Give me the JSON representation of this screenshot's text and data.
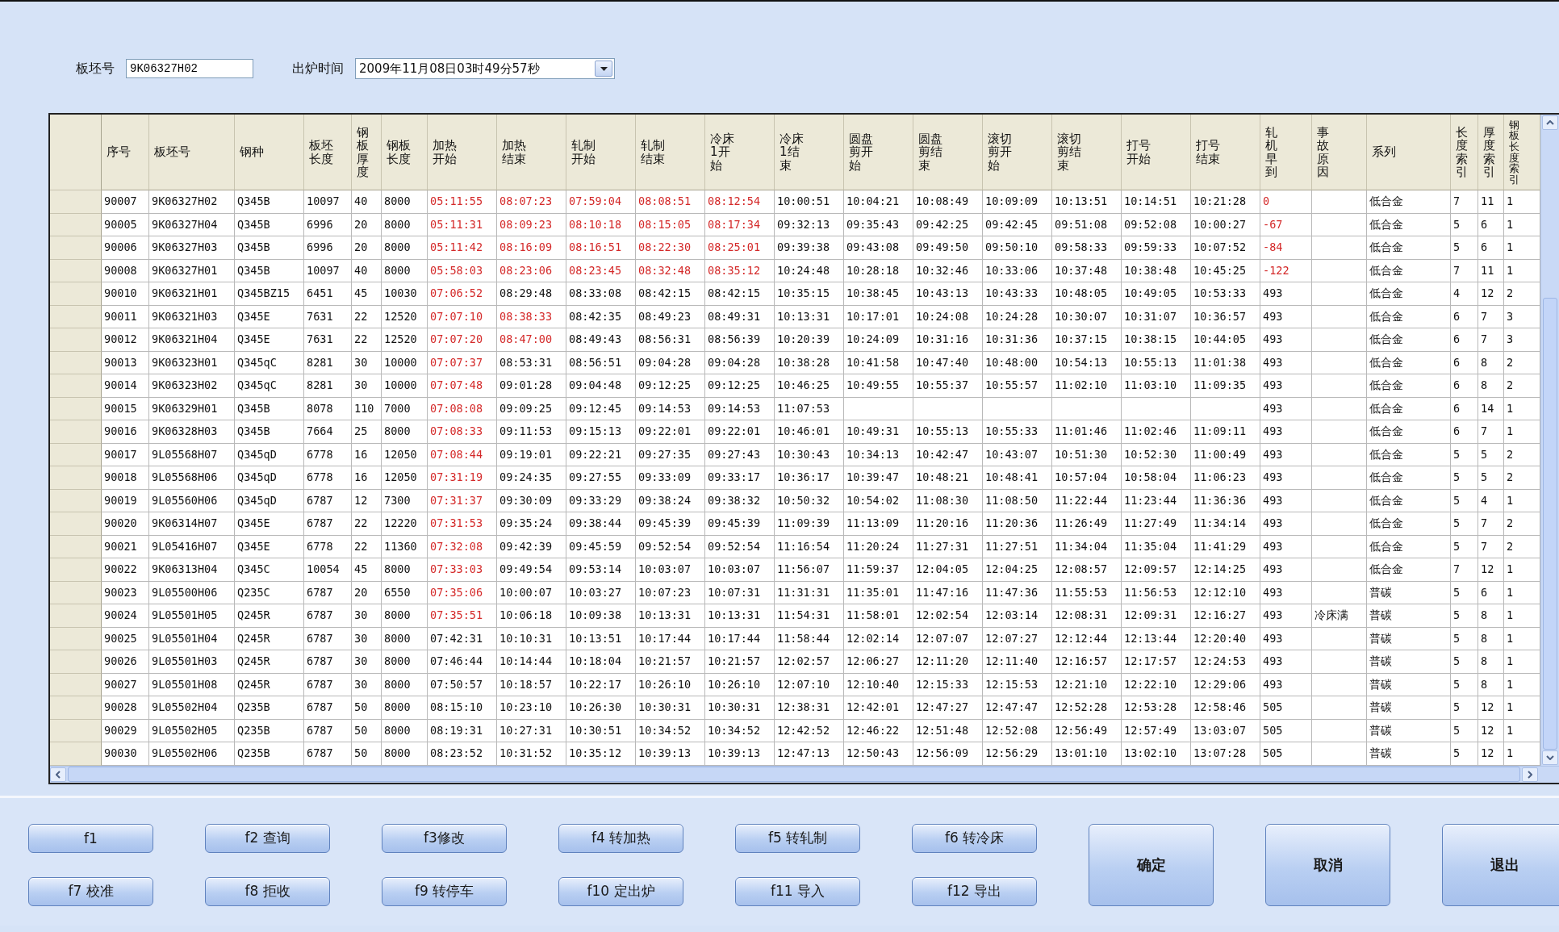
{
  "filter": {
    "slab_label": "板坯号",
    "slab_value": "9K06327H02",
    "time_label": "出炉时间",
    "time_value": "2009年11月08日03时49分57秒"
  },
  "table": {
    "columns": [
      "序号",
      "板坯号",
      "钢种",
      "板坯长度",
      "钢板厚度",
      "钢板长度",
      "加热开始",
      "加热结束",
      "轧制开始",
      "轧制结束",
      "冷床1开始",
      "冷床1结束",
      "圆盘剪开始",
      "圆盘剪结束",
      "滚切剪开始",
      "滚切剪结束",
      "打号开始",
      "打号结束",
      "轧机早到",
      "事故原因",
      "系列",
      "长度索引",
      "厚度索引",
      "钢板长度索引"
    ],
    "rows": [
      {
        "cells": [
          "90007",
          "9K06327H02",
          "Q345B",
          "10097",
          "40",
          "8000",
          "05:11:55",
          "08:07:23",
          "07:59:04",
          "08:08:51",
          "08:12:54",
          "10:00:51",
          "10:04:21",
          "10:08:49",
          "10:09:09",
          "10:13:51",
          "10:14:51",
          "10:21:28",
          "0",
          null,
          "低合金",
          "7",
          "11",
          "1"
        ],
        "alert": [
          true,
          true,
          true,
          true,
          true,
          true
        ]
      },
      {
        "cells": [
          "90005",
          "9K06327H04",
          "Q345B",
          "6996",
          "20",
          "8000",
          "05:11:31",
          "08:09:23",
          "08:10:18",
          "08:15:05",
          "08:17:34",
          "09:32:13",
          "09:35:43",
          "09:42:25",
          "09:42:45",
          "09:51:08",
          "09:52:08",
          "10:00:27",
          "-67",
          null,
          "低合金",
          "5",
          "6",
          "1"
        ],
        "alert": [
          true,
          true,
          true,
          true,
          true,
          true
        ]
      },
      {
        "cells": [
          "90006",
          "9K06327H03",
          "Q345B",
          "6996",
          "20",
          "8000",
          "05:11:42",
          "08:16:09",
          "08:16:51",
          "08:22:30",
          "08:25:01",
          "09:39:38",
          "09:43:08",
          "09:49:50",
          "09:50:10",
          "09:58:33",
          "09:59:33",
          "10:07:52",
          "-84",
          null,
          "低合金",
          "5",
          "6",
          "1"
        ],
        "alert": [
          true,
          true,
          true,
          true,
          true,
          true
        ]
      },
      {
        "cells": [
          "90008",
          "9K06327H01",
          "Q345B",
          "10097",
          "40",
          "8000",
          "05:58:03",
          "08:23:06",
          "08:23:45",
          "08:32:48",
          "08:35:12",
          "10:24:48",
          "10:28:18",
          "10:32:46",
          "10:33:06",
          "10:37:48",
          "10:38:48",
          "10:45:25",
          "-122",
          null,
          "低合金",
          "7",
          "11",
          "1"
        ],
        "alert": [
          true,
          true,
          true,
          true,
          true,
          true
        ]
      },
      {
        "cells": [
          "90010",
          "9K06321H01",
          "Q345BZ15",
          "6451",
          "45",
          "10030",
          "07:06:52",
          "08:29:48",
          "08:33:08",
          "08:42:15",
          "08:42:15",
          "10:35:15",
          "10:38:45",
          "10:43:13",
          "10:43:33",
          "10:48:05",
          "10:49:05",
          "10:53:33",
          "493",
          null,
          "低合金",
          "4",
          "12",
          "2"
        ],
        "alert": [
          true,
          false,
          false,
          false,
          false,
          false
        ]
      },
      {
        "cells": [
          "90011",
          "9K06321H03",
          "Q345E",
          "7631",
          "22",
          "12520",
          "07:07:10",
          "08:38:33",
          "08:42:35",
          "08:49:23",
          "08:49:31",
          "10:13:31",
          "10:17:01",
          "10:24:08",
          "10:24:28",
          "10:30:07",
          "10:31:07",
          "10:36:57",
          "493",
          null,
          "低合金",
          "6",
          "7",
          "3"
        ],
        "alert": [
          true,
          true,
          false,
          false,
          false,
          false
        ]
      },
      {
        "cells": [
          "90012",
          "9K06321H04",
          "Q345E",
          "7631",
          "22",
          "12520",
          "07:07:20",
          "08:47:00",
          "08:49:43",
          "08:56:31",
          "08:56:39",
          "10:20:39",
          "10:24:09",
          "10:31:16",
          "10:31:36",
          "10:37:15",
          "10:38:15",
          "10:44:05",
          "493",
          null,
          "低合金",
          "6",
          "7",
          "3"
        ],
        "alert": [
          true,
          true,
          false,
          false,
          false,
          false
        ]
      },
      {
        "cells": [
          "90013",
          "9K06323H01",
          "Q345qC",
          "8281",
          "30",
          "10000",
          "07:07:37",
          "08:53:31",
          "08:56:51",
          "09:04:28",
          "09:04:28",
          "10:38:28",
          "10:41:58",
          "10:47:40",
          "10:48:00",
          "10:54:13",
          "10:55:13",
          "11:01:38",
          "493",
          null,
          "低合金",
          "6",
          "8",
          "2"
        ],
        "alert": [
          true,
          false,
          false,
          false,
          false,
          false
        ]
      },
      {
        "cells": [
          "90014",
          "9K06323H02",
          "Q345qC",
          "8281",
          "30",
          "10000",
          "07:07:48",
          "09:01:28",
          "09:04:48",
          "09:12:25",
          "09:12:25",
          "10:46:25",
          "10:49:55",
          "10:55:37",
          "10:55:57",
          "11:02:10",
          "11:03:10",
          "11:09:35",
          "493",
          null,
          "低合金",
          "6",
          "8",
          "2"
        ],
        "alert": [
          true,
          false,
          false,
          false,
          false,
          false
        ]
      },
      {
        "cells": [
          "90015",
          "9K06329H01",
          "Q345B",
          "8078",
          "110",
          "7000",
          "07:08:08",
          "09:09:25",
          "09:12:45",
          "09:14:53",
          "09:14:53",
          "11:07:53",
          null,
          null,
          null,
          null,
          null,
          null,
          "493",
          null,
          "低合金",
          "6",
          "14",
          "1"
        ],
        "alert": [
          true,
          false,
          false,
          false,
          false,
          false
        ]
      },
      {
        "cells": [
          "90016",
          "9K06328H03",
          "Q345B",
          "7664",
          "25",
          "8000",
          "07:08:33",
          "09:11:53",
          "09:15:13",
          "09:22:01",
          "09:22:01",
          "10:46:01",
          "10:49:31",
          "10:55:13",
          "10:55:33",
          "11:01:46",
          "11:02:46",
          "11:09:11",
          "493",
          null,
          "低合金",
          "6",
          "7",
          "1"
        ],
        "alert": [
          true,
          false,
          false,
          false,
          false,
          false
        ]
      },
      {
        "cells": [
          "90017",
          "9L05568H07",
          "Q345qD",
          "6778",
          "16",
          "12050",
          "07:08:44",
          "09:19:01",
          "09:22:21",
          "09:27:35",
          "09:27:43",
          "10:30:43",
          "10:34:13",
          "10:42:47",
          "10:43:07",
          "10:51:30",
          "10:52:30",
          "11:00:49",
          "493",
          null,
          "低合金",
          "5",
          "5",
          "2"
        ],
        "alert": [
          true,
          false,
          false,
          false,
          false,
          false
        ]
      },
      {
        "cells": [
          "90018",
          "9L05568H06",
          "Q345qD",
          "6778",
          "16",
          "12050",
          "07:31:19",
          "09:24:35",
          "09:27:55",
          "09:33:09",
          "09:33:17",
          "10:36:17",
          "10:39:47",
          "10:48:21",
          "10:48:41",
          "10:57:04",
          "10:58:04",
          "11:06:23",
          "493",
          null,
          "低合金",
          "5",
          "5",
          "2"
        ],
        "alert": [
          true,
          false,
          false,
          false,
          false,
          false
        ]
      },
      {
        "cells": [
          "90019",
          "9L05560H06",
          "Q345qD",
          "6787",
          "12",
          "7300",
          "07:31:37",
          "09:30:09",
          "09:33:29",
          "09:38:24",
          "09:38:32",
          "10:50:32",
          "10:54:02",
          "11:08:30",
          "11:08:50",
          "11:22:44",
          "11:23:44",
          "11:36:36",
          "493",
          null,
          "低合金",
          "5",
          "4",
          "1"
        ],
        "alert": [
          true,
          false,
          false,
          false,
          false,
          false
        ]
      },
      {
        "cells": [
          "90020",
          "9K06314H07",
          "Q345E",
          "6787",
          "22",
          "12220",
          "07:31:53",
          "09:35:24",
          "09:38:44",
          "09:45:39",
          "09:45:39",
          "11:09:39",
          "11:13:09",
          "11:20:16",
          "11:20:36",
          "11:26:49",
          "11:27:49",
          "11:34:14",
          "493",
          null,
          "低合金",
          "5",
          "7",
          "2"
        ],
        "alert": [
          true,
          false,
          false,
          false,
          false,
          false
        ]
      },
      {
        "cells": [
          "90021",
          "9L05416H07",
          "Q345E",
          "6778",
          "22",
          "11360",
          "07:32:08",
          "09:42:39",
          "09:45:59",
          "09:52:54",
          "09:52:54",
          "11:16:54",
          "11:20:24",
          "11:27:31",
          "11:27:51",
          "11:34:04",
          "11:35:04",
          "11:41:29",
          "493",
          null,
          "低合金",
          "5",
          "7",
          "2"
        ],
        "alert": [
          true,
          false,
          false,
          false,
          false,
          false
        ]
      },
      {
        "cells": [
          "90022",
          "9K06313H04",
          "Q345C",
          "10054",
          "45",
          "8000",
          "07:33:03",
          "09:49:54",
          "09:53:14",
          "10:03:07",
          "10:03:07",
          "11:56:07",
          "11:59:37",
          "12:04:05",
          "12:04:25",
          "12:08:57",
          "12:09:57",
          "12:14:25",
          "493",
          null,
          "低合金",
          "7",
          "12",
          "1"
        ],
        "alert": [
          true,
          false,
          false,
          false,
          false,
          false
        ]
      },
      {
        "cells": [
          "90023",
          "9L05500H06",
          "Q235C",
          "6787",
          "20",
          "6550",
          "07:35:06",
          "10:00:07",
          "10:03:27",
          "10:07:23",
          "10:07:31",
          "11:31:31",
          "11:35:01",
          "11:47:16",
          "11:47:36",
          "11:55:53",
          "11:56:53",
          "12:12:10",
          "493",
          null,
          "普碳",
          "5",
          "6",
          "1"
        ],
        "alert": [
          true,
          false,
          false,
          false,
          false,
          false
        ]
      },
      {
        "cells": [
          "90024",
          "9L05501H05",
          "Q245R",
          "6787",
          "30",
          "8000",
          "07:35:51",
          "10:06:18",
          "10:09:38",
          "10:13:31",
          "10:13:31",
          "11:54:31",
          "11:58:01",
          "12:02:54",
          "12:03:14",
          "12:08:31",
          "12:09:31",
          "12:16:27",
          "493",
          "冷床满",
          "普碳",
          "5",
          "8",
          "1"
        ],
        "alert": [
          true,
          false,
          false,
          false,
          false,
          false
        ]
      },
      {
        "cells": [
          "90025",
          "9L05501H04",
          "Q245R",
          "6787",
          "30",
          "8000",
          "07:42:31",
          "10:10:31",
          "10:13:51",
          "10:17:44",
          "10:17:44",
          "11:58:44",
          "12:02:14",
          "12:07:07",
          "12:07:27",
          "12:12:44",
          "12:13:44",
          "12:20:40",
          "493",
          null,
          "普碳",
          "5",
          "8",
          "1"
        ],
        "alert": [
          false,
          false,
          false,
          false,
          false,
          false
        ]
      },
      {
        "cells": [
          "90026",
          "9L05501H03",
          "Q245R",
          "6787",
          "30",
          "8000",
          "07:46:44",
          "10:14:44",
          "10:18:04",
          "10:21:57",
          "10:21:57",
          "12:02:57",
          "12:06:27",
          "12:11:20",
          "12:11:40",
          "12:16:57",
          "12:17:57",
          "12:24:53",
          "493",
          null,
          "普碳",
          "5",
          "8",
          "1"
        ],
        "alert": [
          false,
          false,
          false,
          false,
          false,
          false
        ]
      },
      {
        "cells": [
          "90027",
          "9L05501H08",
          "Q245R",
          "6787",
          "30",
          "8000",
          "07:50:57",
          "10:18:57",
          "10:22:17",
          "10:26:10",
          "10:26:10",
          "12:07:10",
          "12:10:40",
          "12:15:33",
          "12:15:53",
          "12:21:10",
          "12:22:10",
          "12:29:06",
          "493",
          null,
          "普碳",
          "5",
          "8",
          "1"
        ],
        "alert": [
          false,
          false,
          false,
          false,
          false,
          false
        ]
      },
      {
        "cells": [
          "90028",
          "9L05502H04",
          "Q235B",
          "6787",
          "50",
          "8000",
          "08:15:10",
          "10:23:10",
          "10:26:30",
          "10:30:31",
          "10:30:31",
          "12:38:31",
          "12:42:01",
          "12:47:27",
          "12:47:47",
          "12:52:28",
          "12:53:28",
          "12:58:46",
          "505",
          null,
          "普碳",
          "5",
          "12",
          "1"
        ],
        "alert": [
          false,
          false,
          false,
          false,
          false,
          false
        ]
      },
      {
        "cells": [
          "90029",
          "9L05502H05",
          "Q235B",
          "6787",
          "50",
          "8000",
          "08:19:31",
          "10:27:31",
          "10:30:51",
          "10:34:52",
          "10:34:52",
          "12:42:52",
          "12:46:22",
          "12:51:48",
          "12:52:08",
          "12:56:49",
          "12:57:49",
          "13:03:07",
          "505",
          null,
          "普碳",
          "5",
          "12",
          "1"
        ],
        "alert": [
          false,
          false,
          false,
          false,
          false,
          false
        ]
      },
      {
        "cells": [
          "90030",
          "9L05502H06",
          "Q235B",
          "6787",
          "50",
          "8000",
          "08:23:52",
          "10:31:52",
          "10:35:12",
          "10:39:13",
          "10:39:13",
          "12:47:13",
          "12:50:43",
          "12:56:09",
          "12:56:29",
          "13:01:10",
          "13:02:10",
          "13:07:28",
          "505",
          null,
          "普碳",
          "5",
          "12",
          "1"
        ],
        "alert": [
          false,
          false,
          false,
          false,
          false,
          false
        ]
      }
    ]
  },
  "buttons": [
    {
      "label": "f1",
      "kind": "function"
    },
    {
      "label": "f2 查询",
      "kind": "function"
    },
    {
      "label": "f3修改",
      "kind": "function"
    },
    {
      "label": "f4 转加热",
      "kind": "function"
    },
    {
      "label": "f5 转轧制",
      "kind": "function"
    },
    {
      "label": "f6 转冷床",
      "kind": "function"
    },
    {
      "label": "f7 校准",
      "kind": "function"
    },
    {
      "label": "f8 拒收",
      "kind": "function"
    },
    {
      "label": "f9 转停车",
      "kind": "function"
    },
    {
      "label": "f10 定出炉",
      "kind": "function"
    },
    {
      "label": "f11 导入",
      "kind": "function"
    },
    {
      "label": "f12 导出",
      "kind": "function"
    },
    {
      "label": "确定",
      "kind": "large"
    },
    {
      "label": "取消",
      "kind": "large"
    },
    {
      "label": "退出",
      "kind": "large"
    }
  ]
}
